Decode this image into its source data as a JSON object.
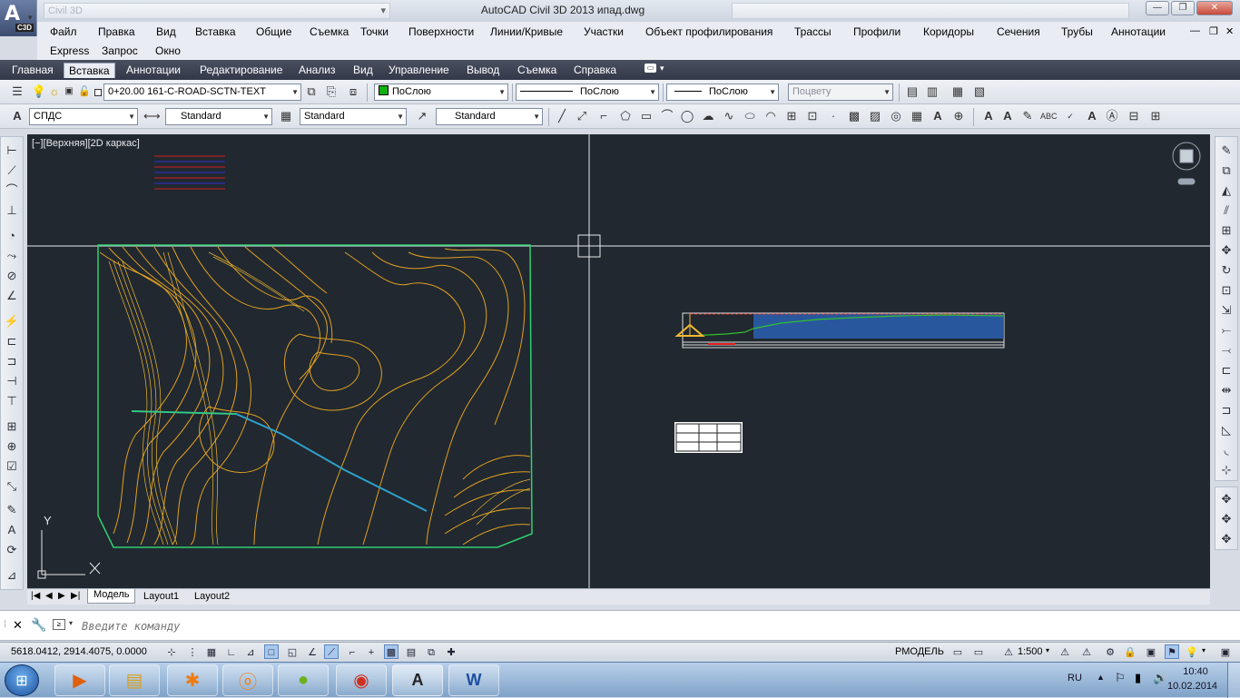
{
  "title_bar": {
    "app_badge": "C3D",
    "workspace": "Civil 3D",
    "window_title": "AutoCAD Civil 3D 2013    ипад.dwg",
    "minimize": "—",
    "restore": "❐",
    "close": "✕"
  },
  "menu": {
    "row1": [
      "Файл",
      "Правка",
      "Вид",
      "Вставка",
      "Общие",
      "Съемка",
      "Точки",
      "Поверхности",
      "Линии/Кривые",
      "Участки",
      "Объект профилирования",
      "Трассы",
      "Профили",
      "Коридоры",
      "Сечения",
      "Трубы",
      "Аннотации"
    ],
    "row2": [
      "Express",
      "Запрос",
      "Окно"
    ],
    "doc_controls": [
      "—",
      "❐",
      "✕"
    ]
  },
  "ribbon_tabs": [
    "Главная",
    "Вставка",
    "Аннотации",
    "Редактирование",
    "Анализ",
    "Вид",
    "Управление",
    "Вывод",
    "Съемка",
    "Справка"
  ],
  "ribbon_active": "Вставка",
  "layer_toolbar": {
    "layer": "0+20.00 161-C-ROAD-SCTN-TEXT",
    "color": "ПоСлою",
    "linetype": "ПоСлою",
    "lineweight": "ПоСлою",
    "plotstyle": "Поцвету"
  },
  "styles_toolbar": {
    "text_style": "СПДС",
    "dim_style": "Standard",
    "table_style": "Standard",
    "mleader_style": "Standard"
  },
  "viewport_label": "[−][Верхняя][2D каркас]",
  "ucs": {
    "y": "Y"
  },
  "layout_tabs": [
    "Модель",
    "Layout1",
    "Layout2"
  ],
  "active_layout": "Модель",
  "command_placeholder": "Введите команду",
  "status": {
    "coords": "5618.0412, 2914.4075, 0.0000",
    "space": "РМОДЕЛЬ",
    "scale": "1:500"
  },
  "taskbar": {
    "lang": "RU",
    "time": "10:40",
    "date": "10.02.2014"
  },
  "colors": {
    "canvas": "#212830",
    "contour": "#e0a020",
    "boundary": "#30d070",
    "alignment": "#2fa0c8"
  }
}
